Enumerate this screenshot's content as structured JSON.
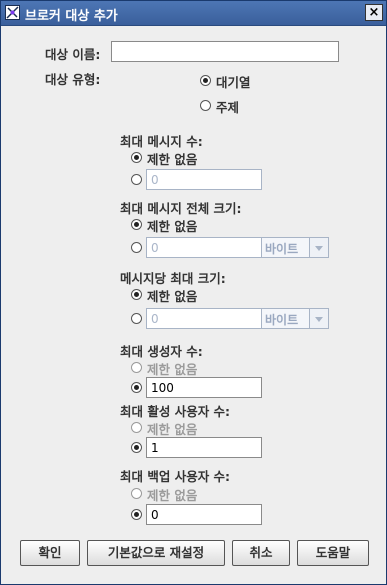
{
  "window": {
    "title": "브로커 대상 추가",
    "close_glyph": "×"
  },
  "fields": {
    "dest_name": {
      "label": "대상 이름:",
      "value": ""
    },
    "dest_type": {
      "label": "대상 유형:",
      "options": [
        "대기열",
        "주제"
      ],
      "selected": "대기열"
    }
  },
  "max_messages": {
    "label": "최대 메시지 수:",
    "unlimited_label": "제한 없음",
    "selected": "unlimited",
    "value": "0"
  },
  "max_total_size": {
    "label": "최대 메시지 전체 크기:",
    "unlimited_label": "제한 없음",
    "selected": "unlimited",
    "value": "0",
    "unit": "바이트"
  },
  "max_size_per_msg": {
    "label": "메시지당 최대 크기:",
    "unlimited_label": "제한 없음",
    "selected": "unlimited",
    "value": "0",
    "unit": "바이트"
  },
  "max_producers": {
    "label": "최대 생성자 수:",
    "unlimited_label": "제한 없음",
    "selected": "value",
    "value": "100"
  },
  "max_active_consumers": {
    "label": "최대 활성 사용자 수:",
    "unlimited_label": "제한 없음",
    "selected": "value",
    "value": "1"
  },
  "max_backup_consumers": {
    "label": "최대 백업 사용자 수:",
    "unlimited_label": "제한 없음",
    "selected": "value",
    "value": "0"
  },
  "buttons": {
    "ok": "확인",
    "defaults": "기본값으로 재설정",
    "cancel": "취소",
    "help": "도움말"
  }
}
